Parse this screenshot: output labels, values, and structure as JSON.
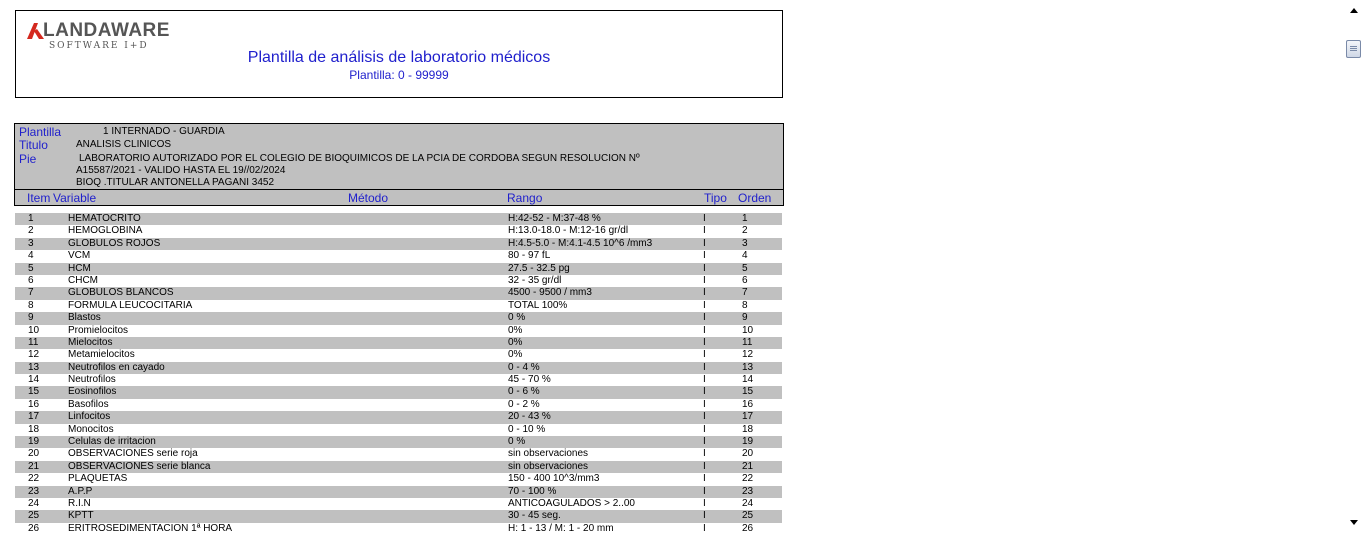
{
  "header": {
    "logo_name": "LANDAWARE",
    "logo_sub": "SOFTWARE I+D",
    "title": "Plantilla de análisis de laboratorio médicos",
    "subtitle": "Plantilla: 0 - 99999"
  },
  "info": {
    "plantilla_label": "Plantilla",
    "plantilla_value": "1 INTERNADO - GUARDIA",
    "titulo_label": "Titulo",
    "titulo_value": "ANALISIS CLINICOS",
    "pie_label": "Pie",
    "pie_line1": "LABORATORIO  AUTORIZADO POR EL COLEGIO DE BIOQUIMICOS DE LA PCIA DE  CORDOBA SEGUN RESOLUCION Nº",
    "pie_line2": "A15587/2021 - VALIDO HASTA  EL 19//02/2024",
    "pie_line3": "BIOQ .TITULAR ANTONELLA PAGANI 3452"
  },
  "columns": {
    "item": "Item",
    "variable": "Variable",
    "metodo": "Método",
    "rango": "Rango",
    "tipo": "Tipo",
    "orden": "Orden"
  },
  "rows": [
    {
      "item": "1",
      "variable": "HEMATOCRITO",
      "rango": "H:42-52 - M:37-48   %",
      "tipo": "I",
      "orden": "1"
    },
    {
      "item": "2",
      "variable": "HEMOGLOBINA",
      "rango": "H:13.0-18.0 - M:12-16   gr/dl",
      "tipo": "I",
      "orden": "2"
    },
    {
      "item": "3",
      "variable": "GLOBULOS ROJOS",
      "rango": "H:4.5-5.0 - M:4.1-4.5   10^6 /mm3",
      "tipo": "I",
      "orden": "3"
    },
    {
      "item": "4",
      "variable": "VCM",
      "rango": "80 - 97  fL",
      "tipo": "I",
      "orden": "4"
    },
    {
      "item": "5",
      "variable": "HCM",
      "rango": "27.5 - 32.5   pg",
      "tipo": "I",
      "orden": "5"
    },
    {
      "item": "6",
      "variable": "CHCM",
      "rango": "32 - 35 gr/dl",
      "tipo": "I",
      "orden": "6"
    },
    {
      "item": "7",
      "variable": "GLOBULOS BLANCOS",
      "rango": "4500 - 9500  / mm3",
      "tipo": "I",
      "orden": "7"
    },
    {
      "item": "8",
      "variable": "FORMULA  LEUCOCITARIA",
      "rango": " TOTAL  100%",
      "tipo": "I",
      "orden": "8"
    },
    {
      "item": "9",
      "variable": "Blastos",
      "rango": "0 %",
      "tipo": "I",
      "orden": "9"
    },
    {
      "item": "10",
      "variable": "Promielocitos",
      "rango": "0%",
      "tipo": "I",
      "orden": "10"
    },
    {
      "item": "11",
      "variable": "Mielocitos",
      "rango": "0%",
      "tipo": "I",
      "orden": "11"
    },
    {
      "item": "12",
      "variable": "Metamielocitos",
      "rango": "0%",
      "tipo": "I",
      "orden": "12"
    },
    {
      "item": "13",
      "variable": "Neutrofilos  en cayado",
      "rango": "0 - 4 %",
      "tipo": "I",
      "orden": "13"
    },
    {
      "item": "14",
      "variable": "Neutrofilos",
      "rango": "45 - 70 %",
      "tipo": "I",
      "orden": "14"
    },
    {
      "item": "15",
      "variable": "Eosinofilos",
      "rango": "0 - 6 %",
      "tipo": "I",
      "orden": "15"
    },
    {
      "item": "16",
      "variable": "Basofilos",
      "rango": "0 - 2 %",
      "tipo": "I",
      "orden": "16"
    },
    {
      "item": "17",
      "variable": "Linfocitos",
      "rango": "20 - 43 %",
      "tipo": "I",
      "orden": "17"
    },
    {
      "item": "18",
      "variable": "Monocitos",
      "rango": "0 - 10 %",
      "tipo": "I",
      "orden": "18"
    },
    {
      "item": "19",
      "variable": "Celulas de irritacion",
      "rango": "0 %",
      "tipo": "I",
      "orden": "19"
    },
    {
      "item": "20",
      "variable": "OBSERVACIONES  serie  roja",
      "rango": "sin  observaciones",
      "tipo": "I",
      "orden": "20"
    },
    {
      "item": "21",
      "variable": "OBSERVACIONES  serie  blanca",
      "rango": "sin  observaciones",
      "tipo": "I",
      "orden": "21"
    },
    {
      "item": "22",
      "variable": "PLAQUETAS",
      "rango": "150 - 400 10^3/mm3",
      "tipo": "I",
      "orden": "22"
    },
    {
      "item": "23",
      "variable": "A.P.P",
      "rango": "70 - 100 %",
      "tipo": "I",
      "orden": "23"
    },
    {
      "item": "24",
      "variable": "R.I.N",
      "rango": "ANTICOAGULADOS  > 2..00",
      "tipo": "I",
      "orden": "24"
    },
    {
      "item": "25",
      "variable": "KPTT",
      "rango": "30 - 45 seg.",
      "tipo": "I",
      "orden": "25"
    },
    {
      "item": "26",
      "variable": "ERITROSEDIMENTACION  1ª HORA",
      "rango": "H: 1 - 13 / M: 1 - 20  mm",
      "tipo": "I",
      "orden": "26"
    }
  ]
}
